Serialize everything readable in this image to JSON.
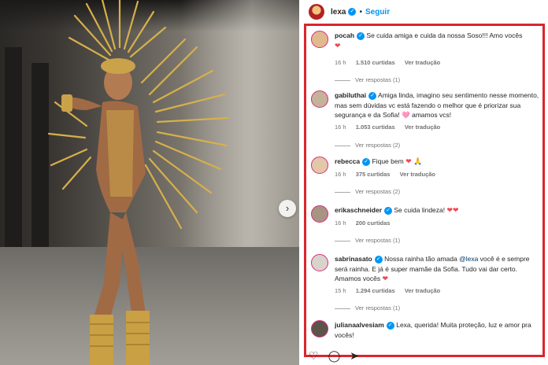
{
  "header": {
    "username": "lexa",
    "separator": "•",
    "follow_label": "Seguir"
  },
  "comments": [
    {
      "username": "pocah",
      "text": "Se cuida amiga e cuida da nossa Soso!!! Amo vocês",
      "emoji": "❤",
      "time": "16 h",
      "likes": "1.510 curtidas",
      "translate": "Ver tradução",
      "replies": "Ver respostas (1)"
    },
    {
      "username": "gabiluthai",
      "text": "Amiga linda, imagino seu sentimento nesse momento, mas sem dúvidas vc está fazendo o melhor que é priorizar sua segurança e da Sofia! 🩷 amamos vcs!",
      "time": "16 h",
      "likes": "1.053 curtidas",
      "translate": "Ver tradução",
      "replies": "Ver respostas (2)"
    },
    {
      "username": "rebecca",
      "text": "Fique bem",
      "emoji": "❤ 🙏",
      "time": "16 h",
      "likes": "375 curtidas",
      "translate": "Ver tradução",
      "replies": "Ver respostas (2)"
    },
    {
      "username": "erikaschneider",
      "text": "Se cuida lindeza!",
      "emoji": "❤❤",
      "time": "16 h",
      "likes": "200 curtidas",
      "replies": "Ver respostas (1)"
    },
    {
      "username": "sabrinasato",
      "text_before_mention": "Nossa rainha tão amada ",
      "mention": "@lexa",
      "text_after_mention": " você é e sempre será rainha. E já é super mamãe da Sofia. Tudo vai dar certo. Amamos vocês",
      "emoji": "❤",
      "time": "15 h",
      "likes": "1.294 curtidas",
      "translate": "Ver tradução",
      "replies": "Ver respostas (1)"
    },
    {
      "username": "julianaalvesiam",
      "text": "Lexa, querida! Muita proteção, luz e amor pra vocês!"
    }
  ],
  "icons": {
    "verified": "verified-badge-icon",
    "heart": "heart-icon",
    "comment": "comment-icon",
    "share": "share-icon",
    "next": "chevron-right-icon"
  },
  "colors": {
    "accent": "#0095f6",
    "highlight_border": "#d9262c",
    "heart": "#ed4956"
  }
}
